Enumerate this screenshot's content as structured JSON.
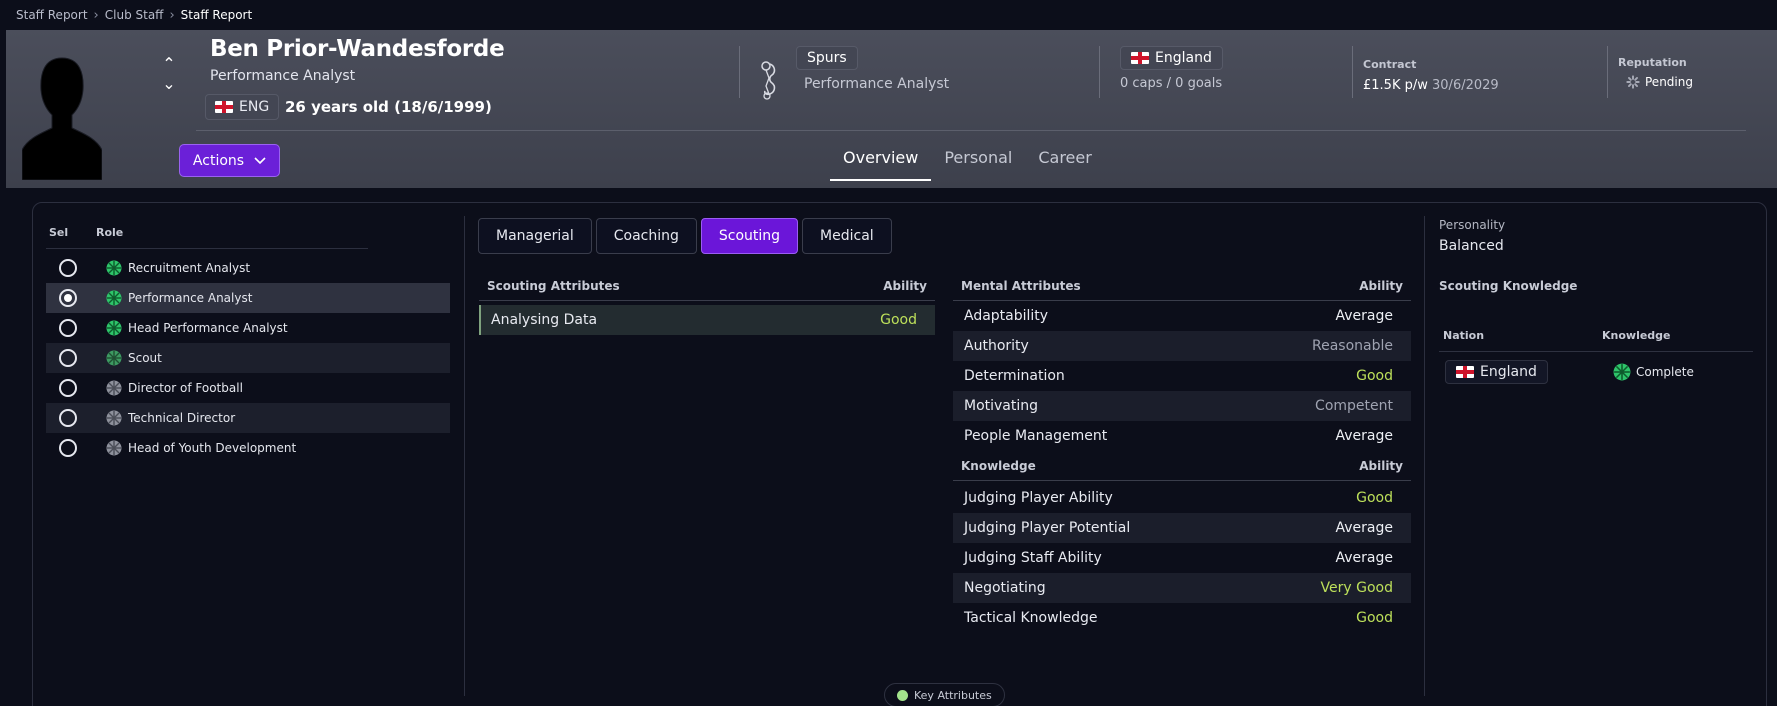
{
  "breadcrumb": [
    "Staff Report",
    "Club Staff",
    "Staff Report"
  ],
  "header": {
    "name": "Ben Prior-Wandesforde",
    "role": "Performance Analyst",
    "nationality_code": "ENG",
    "age_text": "26 years old (18/6/1999)",
    "actions_label": "Actions",
    "club": "Spurs",
    "club_role": "Performance Analyst",
    "country": "England",
    "caps_goals": "0 caps / 0 goals",
    "contract_label": "Contract",
    "contract_wage": "£1.5K p/w",
    "contract_expiry": "30/6/2029",
    "reputation_label": "Reputation",
    "reputation_value": "Pending"
  },
  "page_tabs": [
    {
      "label": "Overview",
      "active": true
    },
    {
      "label": "Personal",
      "active": false
    },
    {
      "label": "Career",
      "active": false
    }
  ],
  "roles": {
    "col_sel": "Sel",
    "col_role": "Role",
    "items": [
      {
        "label": "Recruitment Analyst",
        "selected": false,
        "icon": "green-rating-icon"
      },
      {
        "label": "Performance Analyst",
        "selected": true,
        "icon": "green-rating-icon"
      },
      {
        "label": "Head Performance Analyst",
        "selected": false,
        "icon": "green-rating-icon"
      },
      {
        "label": "Scout",
        "selected": false,
        "icon": "green-rating-icon"
      },
      {
        "label": "Director of Football",
        "selected": false,
        "icon": "grey-rating-icon"
      },
      {
        "label": "Technical Director",
        "selected": false,
        "icon": "grey-rating-icon"
      },
      {
        "label": "Head of Youth Development",
        "selected": false,
        "icon": "grey-rating-icon"
      }
    ]
  },
  "category_tabs": [
    {
      "label": "Managerial",
      "active": false
    },
    {
      "label": "Coaching",
      "active": false
    },
    {
      "label": "Scouting",
      "active": true
    },
    {
      "label": "Medical",
      "active": false
    }
  ],
  "scouting_attributes": {
    "title": "Scouting Attributes",
    "ability_label": "Ability",
    "rows": [
      {
        "name": "Analysing Data",
        "value": "Good"
      }
    ]
  },
  "mental_attributes": {
    "title": "Mental Attributes",
    "ability_label": "Ability",
    "rows": [
      {
        "name": "Adaptability",
        "value": "Average"
      },
      {
        "name": "Authority",
        "value": "Reasonable"
      },
      {
        "name": "Determination",
        "value": "Good"
      },
      {
        "name": "Motivating",
        "value": "Competent"
      },
      {
        "name": "People Management",
        "value": "Average"
      }
    ]
  },
  "knowledge_attributes": {
    "title": "Knowledge",
    "ability_label": "Ability",
    "rows": [
      {
        "name": "Judging Player Ability",
        "value": "Good"
      },
      {
        "name": "Judging Player Potential",
        "value": "Average"
      },
      {
        "name": "Judging Staff Ability",
        "value": "Average"
      },
      {
        "name": "Negotiating",
        "value": "Very Good"
      },
      {
        "name": "Tactical Knowledge",
        "value": "Good"
      }
    ]
  },
  "personality": {
    "label": "Personality",
    "value": "Balanced"
  },
  "scouting_knowledge": {
    "title": "Scouting Knowledge",
    "col_nation": "Nation",
    "col_knowledge": "Knowledge",
    "rows": [
      {
        "nation": "England",
        "knowledge": "Complete"
      }
    ]
  },
  "key_attributes_label": "Key Attributes",
  "colors": {
    "accent": "#6b16d9",
    "good": "#bde05a",
    "rating_green": "#2ec46a"
  }
}
